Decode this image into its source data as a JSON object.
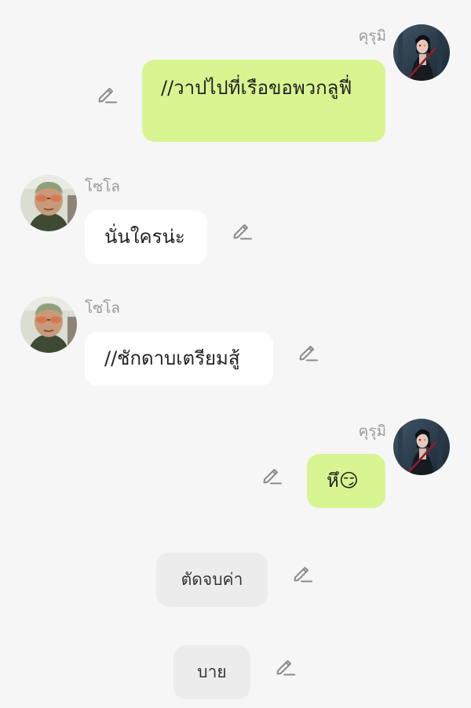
{
  "messages": [
    {
      "sender": "คุรุมิ",
      "side": "right",
      "style": "green",
      "text": "//วาปไปที่เรือขอพวกลูฟี่",
      "avatar_icon": "kurumi-avatar-icon",
      "edit_icon": "pencil-edit-icon"
    },
    {
      "sender": "โซโล",
      "side": "left",
      "style": "white",
      "text": "นั่นใครน่ะ",
      "avatar_icon": "zoro-avatar-icon",
      "edit_icon": "pencil-edit-icon"
    },
    {
      "sender": "โซโล",
      "side": "left",
      "style": "white",
      "text": "//ชักดาบเตรียมสู้",
      "avatar_icon": "zoro-avatar-icon",
      "edit_icon": "pencil-edit-icon"
    },
    {
      "sender": "คุรุมิ",
      "side": "right",
      "style": "green",
      "text": "หึ😏",
      "avatar_icon": "kurumi-avatar-icon",
      "edit_icon": "pencil-edit-icon"
    },
    {
      "sender": "",
      "side": "center",
      "style": "gray",
      "text": "ตัดจบค่า",
      "edit_icon": "pencil-edit-icon"
    },
    {
      "sender": "",
      "side": "center",
      "style": "gray",
      "text": "บาย",
      "edit_icon": "pencil-edit-icon"
    }
  ],
  "colors": {
    "background": "#f6f6f6",
    "bubble_green": "#d9f592",
    "bubble_white": "#ffffff",
    "bubble_gray": "#ececec",
    "name_gray": "#9a9a9a",
    "icon_gray": "#8a8a8a"
  }
}
